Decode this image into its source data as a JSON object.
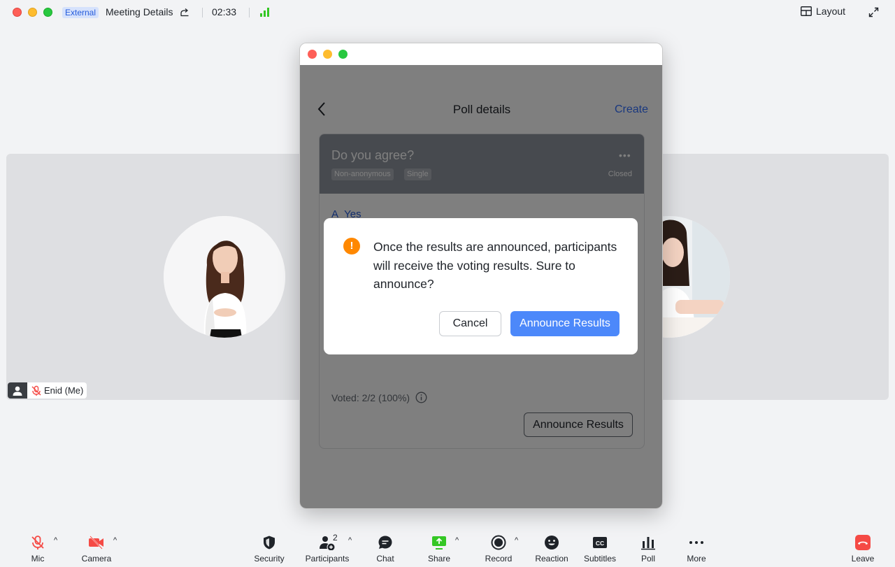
{
  "titlebar": {
    "external_badge": "External",
    "meeting_title": "Meeting Details",
    "timer": "02:33",
    "layout_label": "Layout"
  },
  "participants_view": {
    "self_name": "Enid (Me)"
  },
  "poll": {
    "header_title": "Poll details",
    "create_label": "Create",
    "question": "Do you agree?",
    "tags": [
      "Non-anonymous",
      "Single"
    ],
    "status": "Closed",
    "option_letter": "A",
    "option_text": "Yes",
    "voted_text": "Voted: 2/2 (100%)",
    "announce_button": "Announce Results"
  },
  "dialog": {
    "message": "Once the results are announced, participants will receive the voting results. Sure to announce?",
    "cancel_label": "Cancel",
    "confirm_label": "Announce Results"
  },
  "toolbar": {
    "mic": "Mic",
    "camera": "Camera",
    "security": "Security",
    "participants": "Participants",
    "participants_count": "2",
    "chat": "Chat",
    "share": "Share",
    "record": "Record",
    "reaction": "Reaction",
    "subtitles": "Subtitles",
    "poll": "Poll",
    "more": "More",
    "leave": "Leave"
  },
  "colors": {
    "accent": "#3370ff",
    "primary_button": "#4c88fa",
    "warning": "#ff8800",
    "danger": "#f54a45",
    "share_green": "#34c724"
  }
}
